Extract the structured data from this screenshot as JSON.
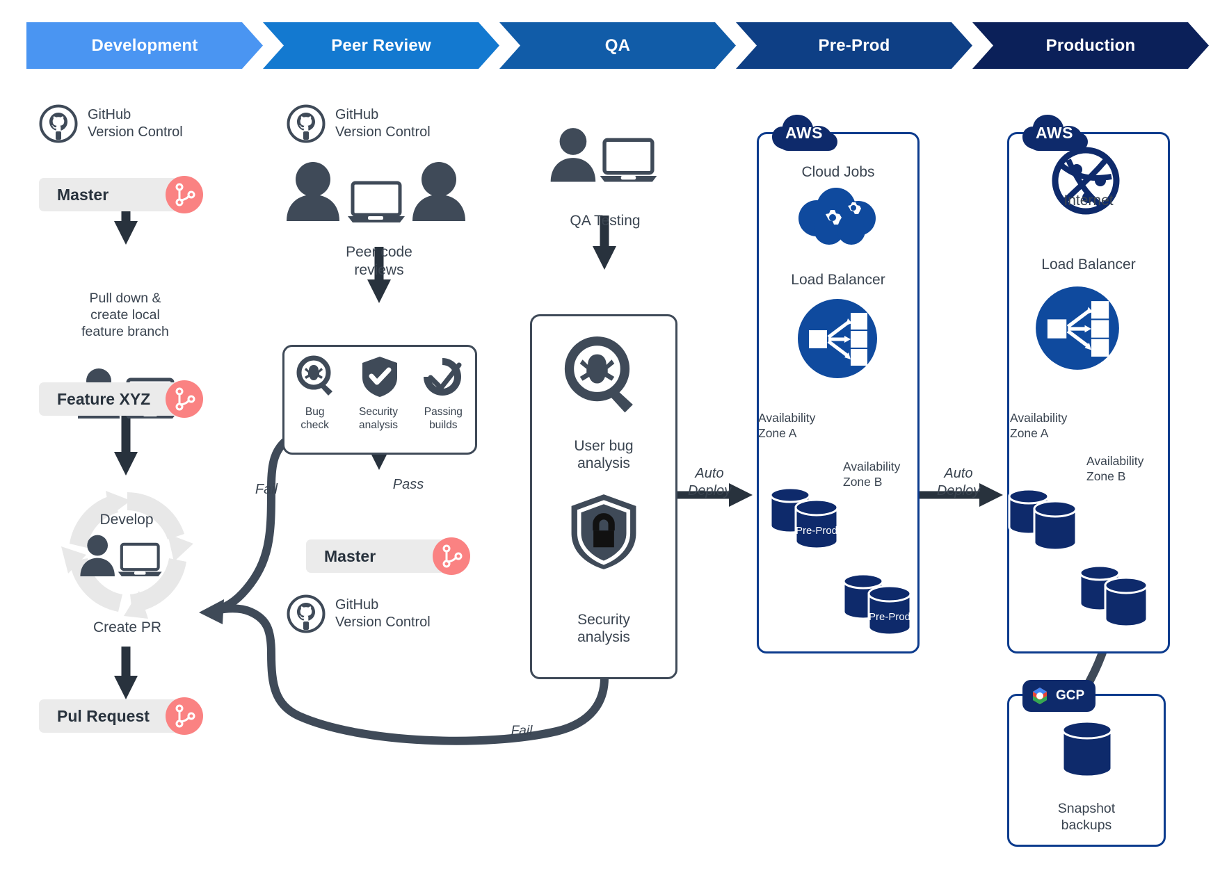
{
  "banner": {
    "stages": [
      {
        "label": "Development",
        "color": "#4a95f2"
      },
      {
        "label": "Peer Review",
        "color": "#1379d0"
      },
      {
        "label": "QA",
        "color": "#115ca8"
      },
      {
        "label": "Pre-Prod",
        "color": "#0e3f85"
      },
      {
        "label": "Production",
        "color": "#0b2059"
      }
    ]
  },
  "colors": {
    "dark": "#3f4a58",
    "pill_bg": "#ebebeb",
    "git_badge": "#fa8282",
    "aws_blue": "#0c3b8d",
    "aws_cloud": "#0e2a6b",
    "lb_blue": "#0f4a9e",
    "db_blue": "#0e2a6b",
    "cycle_grey": "#e8e8e8",
    "text": "#3a4450"
  },
  "development": {
    "github": {
      "line1": "GitHub",
      "line2": "Version Control"
    },
    "master_branch": "Master",
    "pull_note": "Pull down &\ncreate local\nfeature branch",
    "feature_branch": "Feature XYZ",
    "develop_label": "Develop",
    "create_pr": "Create PR",
    "pull_request_branch": "Pul Request"
  },
  "peer_review": {
    "github": {
      "line1": "GitHub",
      "line2": "Version Control"
    },
    "peer_reviews": "Peer code\nreviews",
    "checks": [
      {
        "icon": "bug-magnifier-icon",
        "label": "Bug\ncheck"
      },
      {
        "icon": "shield-check-icon",
        "label": "Security\nanalysis"
      },
      {
        "icon": "build-check-icon",
        "label": "Passing\nbuilds"
      }
    ],
    "fail_label": "Fail",
    "pass_label": "Pass",
    "master_branch": "Master",
    "github_bottom": {
      "line1": "GitHub",
      "line2": "Version Control"
    }
  },
  "qa": {
    "qa_testing": "QA Testing",
    "user_bug_analysis": "User bug\nanalysis",
    "security_analysis": "Security\nanalysis",
    "fail_label": "Fail",
    "auto_deploy": "Auto\nDeploy"
  },
  "preprod": {
    "cloud_tag": "AWS",
    "cloud_jobs": "Cloud Jobs",
    "load_balancer": "Load Balancer",
    "zone_a": "Availability\nZone A",
    "zone_b": "Availability\nZone B",
    "db_a_label": "Pre-Prod",
    "db_b_label": "Pre-Prod",
    "auto_deploy": "Auto\nDeploy"
  },
  "production": {
    "cloud_tag": "AWS",
    "internet": "Internet",
    "load_balancer": "Load Balancer",
    "zone_a": "Availability\nZone A",
    "zone_b": "Availability\nZone B"
  },
  "gcp": {
    "cloud_tag": "GCP",
    "snapshot_backups": "Snapshot\nbackups"
  }
}
